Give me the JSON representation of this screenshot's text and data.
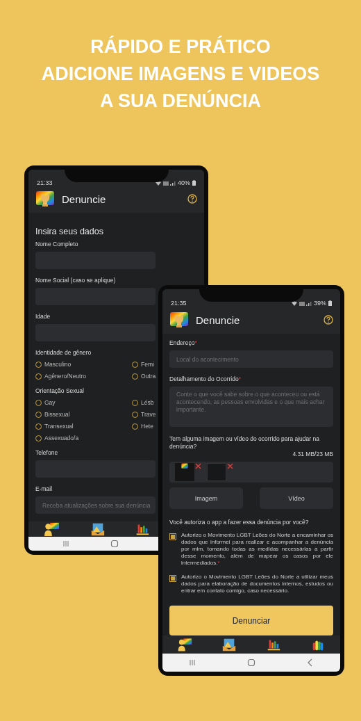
{
  "headline": [
    "RÁPIDO E PRÁTICO",
    "ADICIONE IMAGENS E VIDEOS",
    "A SUA DENÚNCIA"
  ],
  "phones": [
    {
      "status": {
        "time": "21:33",
        "battery": "40%"
      },
      "app_title": "Denuncie",
      "form": [
        {
          "kind": "heading",
          "text": "Insira seus dados"
        },
        {
          "kind": "label",
          "text": "Nome Completo"
        },
        {
          "kind": "field"
        },
        {
          "kind": "label",
          "text": "Nome Social (caso se aplique)"
        },
        {
          "kind": "field"
        },
        {
          "kind": "label",
          "text": "Idade"
        },
        {
          "kind": "field"
        },
        {
          "kind": "label",
          "text": "Identidade de gênero"
        },
        {
          "kind": "radios",
          "options": [
            {
              "label": "Masculino",
              "selected": false
            },
            {
              "label": "Femi",
              "selected": false
            },
            {
              "label": "Agênero/Neutro",
              "selected": false
            },
            {
              "label": "Outra",
              "selected": false
            }
          ]
        },
        {
          "kind": "label",
          "text": "Orientação Sexual"
        },
        {
          "kind": "radios",
          "options": [
            {
              "label": "Gay",
              "selected": false
            },
            {
              "label": "Lésb",
              "selected": false
            },
            {
              "label": "Bissexual",
              "selected": false
            },
            {
              "label": "Trave",
              "selected": false
            },
            {
              "label": "Transexual",
              "selected": false
            },
            {
              "label": "Hete",
              "selected": false
            },
            {
              "label": "Assexuado/a",
              "selected": false
            }
          ]
        },
        {
          "kind": "label",
          "text": "Telefone"
        },
        {
          "kind": "field"
        },
        {
          "kind": "label",
          "text": "E-mail"
        },
        {
          "kind": "field",
          "placeholder": "Receba atualizações sobre sua denúncia"
        }
      ]
    },
    {
      "status": {
        "time": "21:35",
        "battery": "39%"
      },
      "app_title": "Denuncie",
      "form": [
        {
          "kind": "label",
          "text": "Endereço",
          "mark": "*"
        },
        {
          "kind": "field",
          "placeholder": "Local do acontecimento"
        },
        {
          "kind": "label",
          "text": "Detalhamento do Ocorrido",
          "mark": "*"
        },
        {
          "kind": "textarea",
          "placeholder": "Conte o que você sabe sobre o que aconteceu ou está acontecendo, as pessoas envolvidas e o que mais achar importante."
        },
        {
          "kind": "note",
          "text": "Tem alguma imagem ou vídeo do ocorrido para ajudar na denúncia?",
          "aside": "4.31 MB/23 MB"
        },
        {
          "kind": "upload"
        },
        {
          "kind": "buttons",
          "labels": [
            "Imagem",
            "Vídeo"
          ]
        },
        {
          "kind": "note",
          "text": "Você autoriza o app a fazer essa denúncia por você?"
        },
        {
          "kind": "consent",
          "checked": true,
          "text": "Autorizo o Movimento LGBT Leões do Norte a encaminhar os dados que informei para realizar e acompanhar a denúncia por mim, tomando todas as medidas necessárias a partir desse momento, além de mapear os casos por ele intermediados.",
          "mark": "*"
        },
        {
          "kind": "consent",
          "checked": true,
          "text": "Autorizo o Movimento LGBT Leões do Norte a utilizar meus dados para elaboração de documentos internos, estudos ou entrar em contato comigo, caso necessário."
        },
        {
          "kind": "submit",
          "label": "Denunciar"
        }
      ]
    }
  ]
}
